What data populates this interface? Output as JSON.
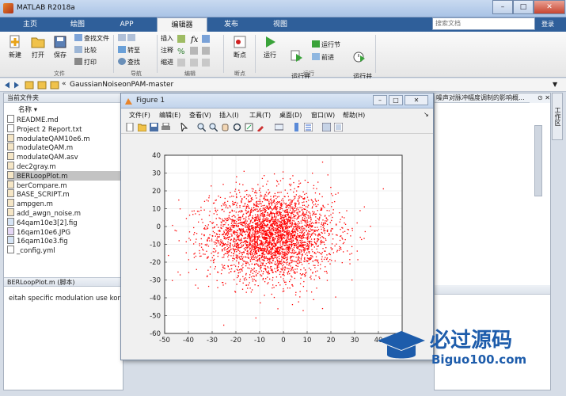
{
  "window": {
    "title": "MATLAB R2018a",
    "min": "–",
    "max": "□",
    "close": "✕"
  },
  "tabs": [
    {
      "label": "主页"
    },
    {
      "label": "绘图"
    },
    {
      "label": "APP"
    },
    {
      "label": "编辑器"
    },
    {
      "label": "发布"
    },
    {
      "label": "视图"
    }
  ],
  "search": {
    "placeholder": "搜索文档"
  },
  "login": "登录",
  "ribbon": {
    "new": "新建",
    "open": "打开",
    "save": "保存",
    "find_files": "查找文件",
    "compare": "比较",
    "print": "打印",
    "goto": "转至",
    "find": "查找",
    "insert": "插入",
    "comment": "注释",
    "indent": "缩进",
    "breakpoints": "断点",
    "run": "运行",
    "run_advance": "运行并\n前进",
    "run_section": "运行节",
    "advance": "前进",
    "run_time": "运行并\n计时",
    "groups": {
      "file": "文件",
      "navigate": "导航",
      "edit": "编辑",
      "breakpoints": "断点",
      "run": "运行"
    }
  },
  "address": {
    "path": "GaussianNoiseonPAM-master"
  },
  "file_panel": {
    "title": "当前文件夹",
    "column": "名称",
    "files": [
      "README.md",
      "Project 2 Report.txt",
      "modulateQAM10e6.m",
      "modulateQAM.m",
      "modulateQAM.asv",
      "dec2gray.m",
      "BERLoopPlot.m",
      "berCompare.m",
      "BASE_SCRIPT.m",
      "ampgen.m",
      "add_awgn_noise.m",
      "64qam10e3[2].fig",
      "16qam10e6.JPG",
      "16qam10e3.fig",
      "_config.yml"
    ],
    "selected_index": 6,
    "details_title": "BERLoopPlot.m (脚本)",
    "details_text": "eitah specific modulation use kore"
  },
  "right_panel": {
    "snippet": "噪声对脉冲幅度调制的影响概...",
    "workspace_label": "工作区"
  },
  "figure": {
    "title": "Figure 1",
    "menus": [
      "文件(F)",
      "编辑(E)",
      "查看(V)",
      "插入(I)",
      "工具(T)",
      "桌面(D)",
      "窗口(W)",
      "帮助(H)"
    ]
  },
  "chart_data": {
    "type": "scatter",
    "title": "",
    "xlabel": "",
    "ylabel": "",
    "xlim": [
      -50,
      50
    ],
    "ylim": [
      -60,
      40
    ],
    "xticks": [
      -50,
      -40,
      -30,
      -20,
      -10,
      0,
      10,
      20,
      30,
      40,
      50
    ],
    "yticks": [
      -60,
      -50,
      -40,
      -30,
      -20,
      -10,
      0,
      10,
      20,
      30,
      40
    ],
    "grid": true,
    "marker_color": "#ff0000",
    "distribution": {
      "kind": "gaussian-cloud",
      "center": [
        -5,
        -5
      ],
      "std": [
        13,
        12
      ],
      "count": 3500
    }
  },
  "watermark": {
    "text": "必过源码",
    "url": "Biguo100.com"
  }
}
